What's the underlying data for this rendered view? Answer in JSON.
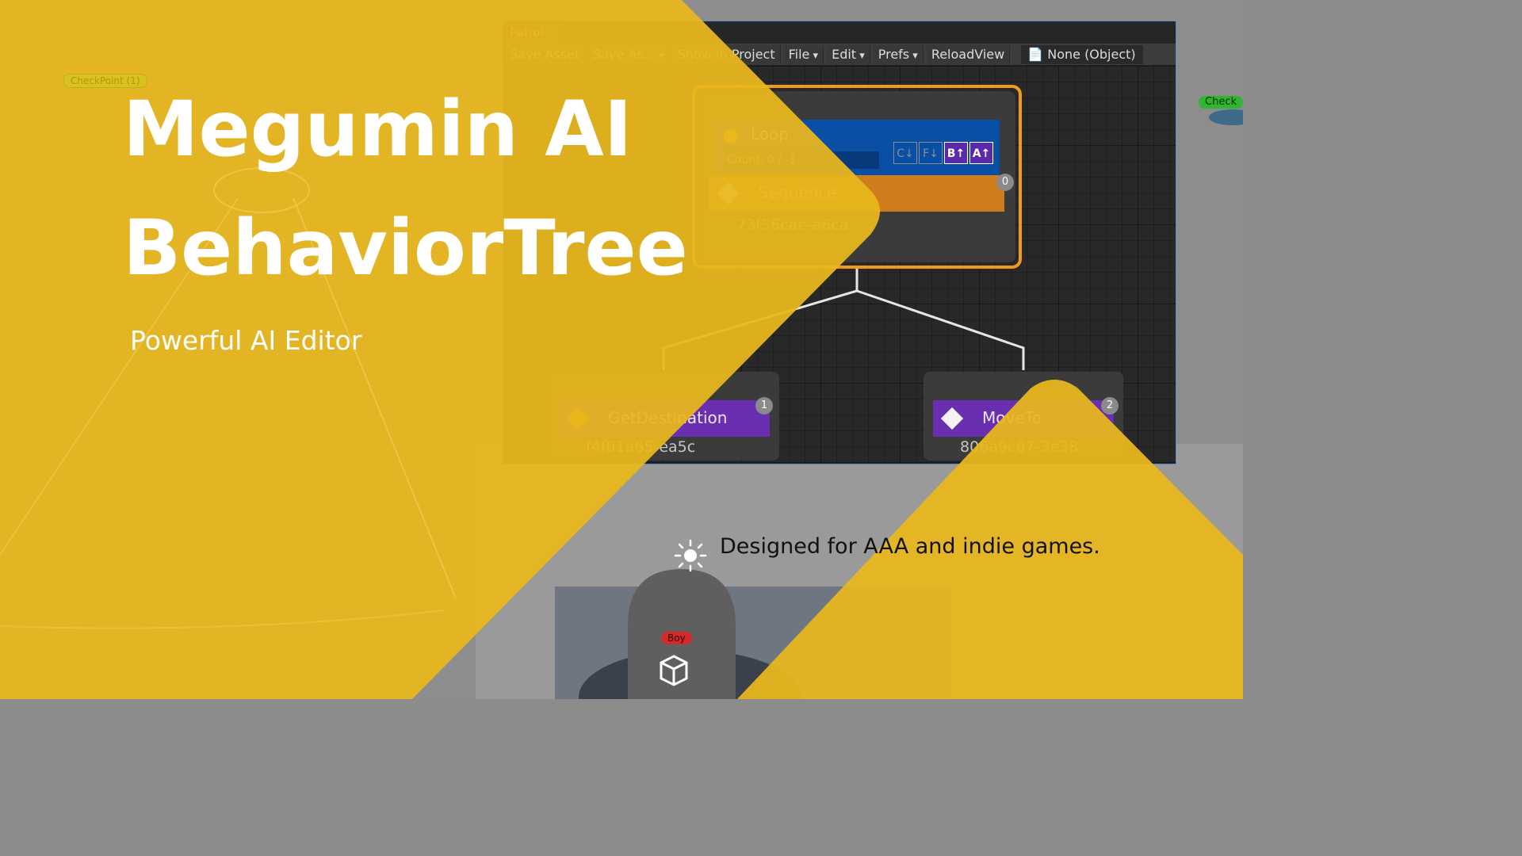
{
  "headline": {
    "line1": "Megumin AI",
    "line2": "BehaviorTree",
    "subtitle": "Powerful AI Editor",
    "tagline": "Designed for AAA and indie games."
  },
  "editor": {
    "tab": "Patrol",
    "toolbar": {
      "save_asset": "Save Asset",
      "save_as": "Save As...",
      "show_in_project": "Show In Project",
      "file": "File",
      "edit": "Edit",
      "prefs": "Prefs",
      "reload_view": "ReloadView",
      "object_field": "None (Object)"
    },
    "nodes": {
      "loop": {
        "title": "Loop",
        "count": "Count: 0 / -1",
        "flags": [
          "C↓",
          "F↓",
          "B↑",
          "A↑"
        ]
      },
      "sequence": {
        "title": "Sequence",
        "guid": "73f56cae-a6ca",
        "index": "0"
      },
      "get_destination": {
        "title": "GetDestination",
        "guid": "f4f01a65-ea5c",
        "index": "1"
      },
      "move_to": {
        "title": "MoveTo",
        "guid": "806a9c87-3e38",
        "index": "2"
      }
    }
  },
  "scene": {
    "checkpoint_left": "CheckPoint (1)",
    "checkpoint_right": "Check",
    "agent_label": "Boy"
  },
  "colors": {
    "overlay_yellow": "#E9B71E",
    "loop_blue": "#0a4fa6",
    "sequence_orange": "#cf7c1c",
    "action_purple": "#6a2fb0",
    "selection_orange": "#f09a1a"
  },
  "icons": [
    "sun-icon",
    "cube-icon",
    "diamond-icon",
    "document-icon"
  ]
}
